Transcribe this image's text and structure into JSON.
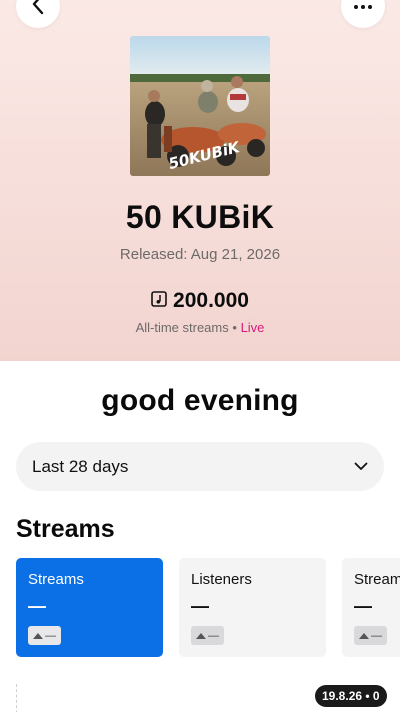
{
  "header": {
    "back_icon": "chevron-left-icon",
    "more_icon": "more-horizontal-icon"
  },
  "album": {
    "title": "50 KUBiK",
    "release": "Released: Aug 21, 2026",
    "cover_text": "50KUBiK",
    "streams_icon": "music-note-icon",
    "streams_value": "200.000",
    "streams_label": "All-time streams",
    "separator": "•",
    "live_label": "Live",
    "live_color": "#d81b7a"
  },
  "greeting": "good evening",
  "period": {
    "selected": "Last 28 days"
  },
  "section_title": "Streams",
  "cards": [
    {
      "label": "Streams",
      "value": "—",
      "trend": "—"
    },
    {
      "label": "Listeners",
      "value": "—",
      "trend": "—"
    },
    {
      "label": "Streams",
      "value": "—",
      "trend": "—"
    }
  ],
  "accent_color": "#0b6fe6",
  "version": "19.8.26 • 0"
}
